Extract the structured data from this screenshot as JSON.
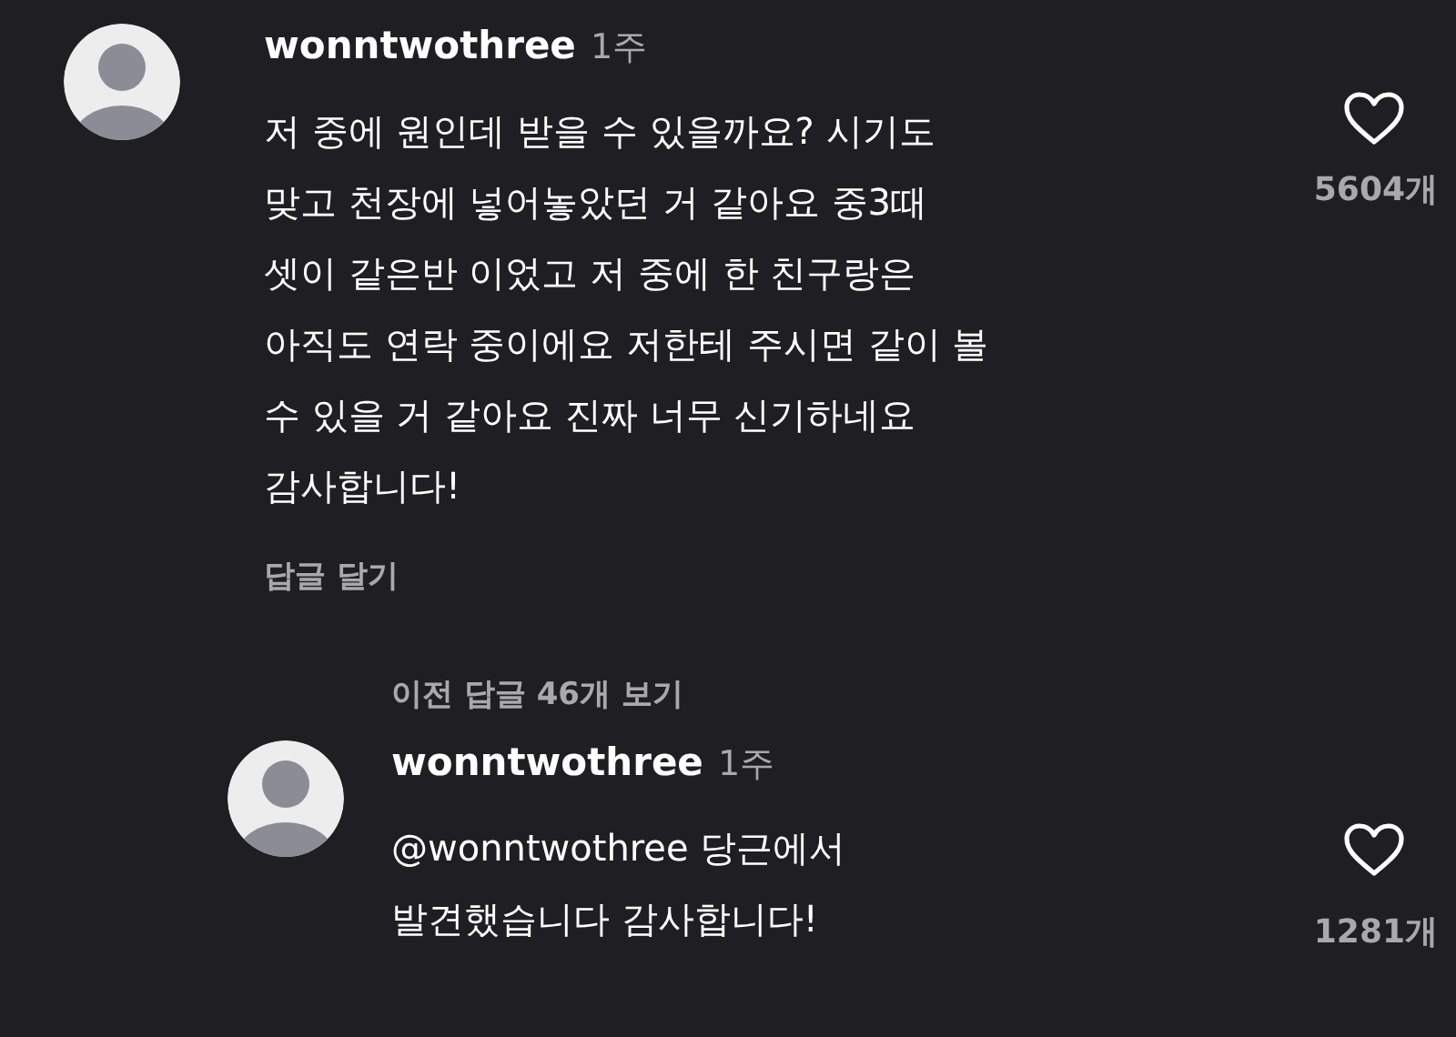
{
  "comments": [
    {
      "username": "wonntwothree",
      "time": "1주",
      "lines": [
        "저 중에 원인데 받을 수 있을까요? 시기도",
        "맞고 천장에 넣어놓았던 거 같아요 중3때",
        "셋이 같은반 이었고 저 중에 한 친구랑은",
        "아직도 연락 중이에요 저한테 주시면 같이 볼",
        "수 있을 거 같아요 진짜 너무 신기하네요",
        "감사합니다!"
      ],
      "likes": "5604개",
      "reply_link": "답글 달기",
      "more_replies": "이전 답글 46개 보기",
      "replies": [
        {
          "username": "wonntwothree",
          "time": "1주",
          "lines": [
            "@wonntwothree 당근에서",
            "발견했습니다 감사합니다!"
          ],
          "likes": "1281개"
        }
      ]
    }
  ]
}
